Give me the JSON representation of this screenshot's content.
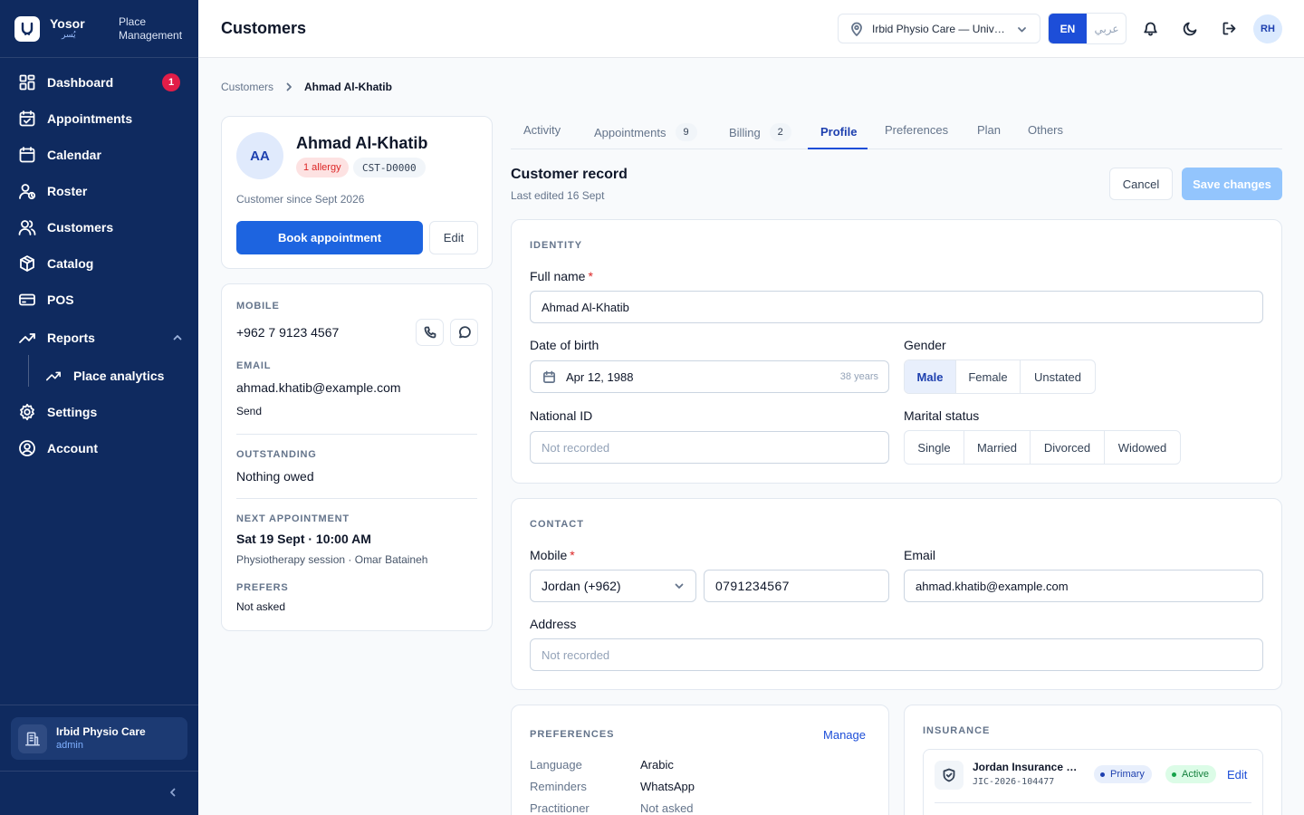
{
  "brand": {
    "name": "Yosor",
    "name_ar": "يُسر",
    "tagline_line1": "Place",
    "tagline_line2": "Management"
  },
  "nav": {
    "dashboard": "Dashboard",
    "dashboard_badge": "1",
    "appointments": "Appointments",
    "calendar": "Calendar",
    "roster": "Roster",
    "customers": "Customers",
    "catalog": "Catalog",
    "pos": "POS",
    "reports": "Reports",
    "place_analytics": "Place analytics",
    "settings": "Settings",
    "account": "Account"
  },
  "workspace": {
    "name": "Irbid Physio Care",
    "role": "admin"
  },
  "topbar": {
    "title": "Customers",
    "location": "Irbid Physio Care — University Street",
    "lang_en": "EN",
    "lang_ar": "عربي",
    "user_initials": "RH"
  },
  "breadcrumb": {
    "parent": "Customers",
    "current": "Ahmad Al-Khatib"
  },
  "profile": {
    "initials": "AA",
    "name": "Ahmad Al-Khatib",
    "allergy_badge": "1 allergy",
    "customer_id": "CST-D0000",
    "since": "Customer since Sept 2026",
    "book_label": "Book appointment",
    "edit_label": "Edit"
  },
  "contact_card": {
    "mobile_label": "MOBILE",
    "mobile": "+962 7 9123 4567",
    "email_label": "EMAIL",
    "email": "ahmad.khatib@example.com",
    "send_label": "Send",
    "outstanding_label": "OUTSTANDING",
    "outstanding": "Nothing owed",
    "next_label": "NEXT APPOINTMENT",
    "next_when": "Sat 19 Sept · 10:00 AM",
    "next_detail": "Physiotherapy session · Omar Bataineh",
    "prefers_label": "PREFERS",
    "prefers": "Not asked"
  },
  "tabs": [
    {
      "label": "Activity",
      "count": ""
    },
    {
      "label": "Appointments",
      "count": "9"
    },
    {
      "label": "Billing",
      "count": "2"
    },
    {
      "label": "Profile",
      "count": ""
    },
    {
      "label": "Preferences",
      "count": ""
    },
    {
      "label": "Plan",
      "count": ""
    },
    {
      "label": "Others",
      "count": ""
    }
  ],
  "record": {
    "title": "Customer record",
    "subtitle": "Last edited 16 Sept",
    "cancel_label": "Cancel",
    "save_label": "Save changes"
  },
  "identity": {
    "section": "IDENTITY",
    "full_name_label": "Full name",
    "full_name": "Ahmad Al-Khatib",
    "dob_label": "Date of birth",
    "dob": "Apr 12, 1988",
    "age": "38 years",
    "gender_label": "Gender",
    "gender_options": [
      "Male",
      "Female",
      "Unstated"
    ],
    "gender_selected": "Male",
    "national_id_label": "National ID",
    "national_id_placeholder": "Not recorded",
    "marital_label": "Marital status",
    "marital_options": [
      "Single",
      "Married",
      "Divorced",
      "Widowed"
    ]
  },
  "contact": {
    "section": "CONTACT",
    "mobile_label": "Mobile",
    "country": "Jordan (+962)",
    "phone": "0791234567",
    "email_label": "Email",
    "email": "ahmad.khatib@example.com",
    "address_label": "Address",
    "address_placeholder": "Not recorded"
  },
  "preferences": {
    "section": "PREFERENCES",
    "manage_label": "Manage",
    "rows": [
      {
        "key": "Language",
        "value": "Arabic"
      },
      {
        "key": "Reminders",
        "value": "WhatsApp"
      },
      {
        "key": "Practitioner",
        "value": "Not asked"
      }
    ]
  },
  "insurance": {
    "section": "INSURANCE",
    "provider": "Jordan Insurance Company",
    "policy": "JIC-2026-104477",
    "primary_label": "Primary",
    "status_label": "Active",
    "edit_label": "Edit"
  },
  "colors": {
    "sidebar": "#0f2a5f",
    "accent": "#1d64e0",
    "danger": "#dc2626",
    "success": "#16a34a"
  }
}
